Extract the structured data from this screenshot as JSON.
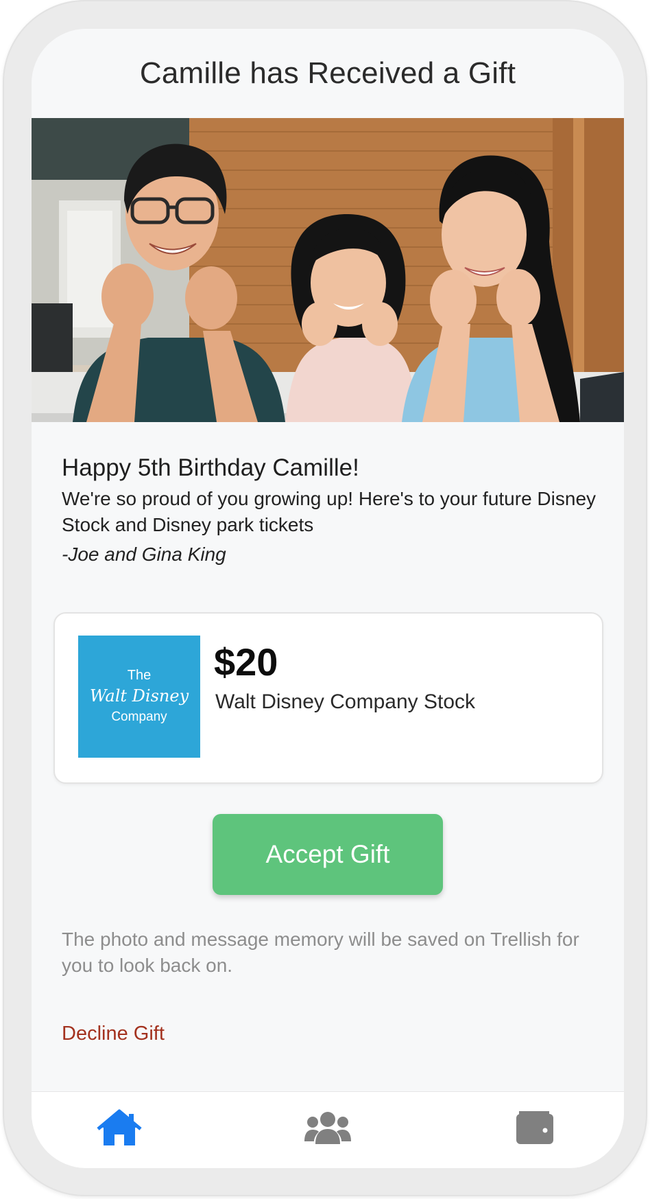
{
  "header": {
    "title": "Camille has Received a Gift"
  },
  "photo": {
    "alt": "Family photo"
  },
  "message": {
    "title": "Happy 5th Birthday Camille!",
    "body": "We're so proud of you growing up! Here's to your future Disney Stock and Disney park tickets",
    "signature": "-Joe and Gina King"
  },
  "gift": {
    "logo_line1": "The",
    "logo_line2": "Walt Disney",
    "logo_line3": "Company",
    "amount": "$20",
    "name": "Walt Disney Company Stock",
    "logo_color": "#2da6d8"
  },
  "actions": {
    "accept_label": "Accept Gift",
    "accept_color": "#5ec47c",
    "note": "The photo and message memory will be saved on Trellish for you to look back on.",
    "decline_label": "Decline Gift",
    "decline_color": "#a3321f"
  },
  "tabbar": {
    "items": [
      {
        "icon": "home-icon",
        "active": true,
        "color": "#1a7cf0"
      },
      {
        "icon": "people-icon",
        "active": false,
        "color": "#808080"
      },
      {
        "icon": "wallet-icon",
        "active": false,
        "color": "#808080"
      }
    ]
  }
}
